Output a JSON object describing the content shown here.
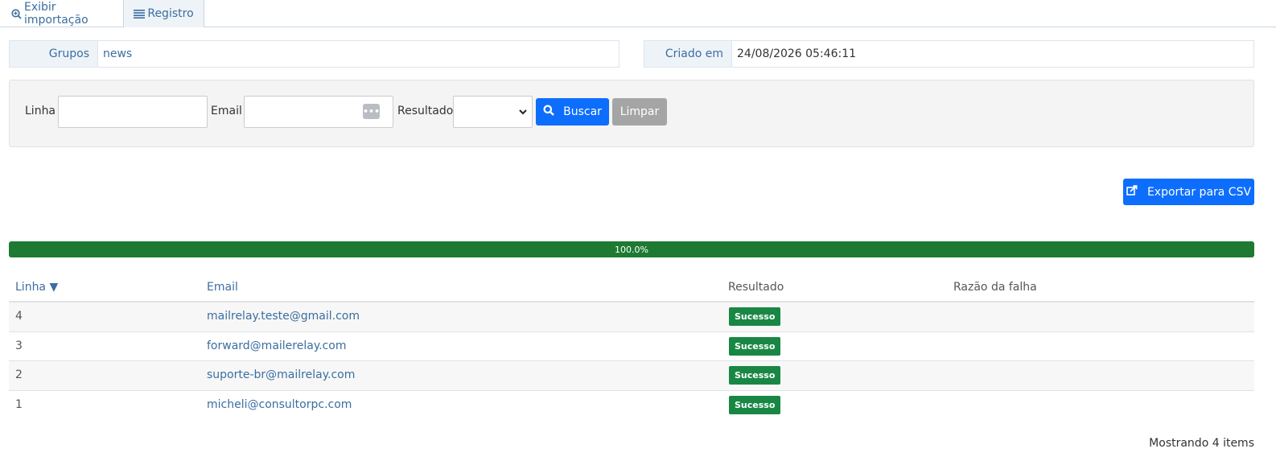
{
  "tabs": [
    {
      "label": "Exibir importação",
      "icon": "search-plus-icon"
    },
    {
      "label": "Registro",
      "icon": "list-icon"
    }
  ],
  "info": {
    "groups_label": "Grupos",
    "groups_value": "news",
    "created_label": "Criado em",
    "created_value": "24/08/2026 05:46:11"
  },
  "filter": {
    "line_label": "Linha",
    "line_value": "",
    "email_label": "Email",
    "email_value": "",
    "result_label": "Resultado",
    "result_selected": "",
    "search_label": "Buscar",
    "clear_label": "Limpar"
  },
  "export_label": "Exportar para CSV",
  "progress": {
    "value": 100.0,
    "text": "100.0%"
  },
  "colors": {
    "primary": "#0d6efd",
    "success": "#198744",
    "progress": "#1e7a32",
    "link": "#3b6ea0"
  },
  "table": {
    "columns": {
      "line": "Linha ▼",
      "email": "Email",
      "result": "Resultado",
      "reason": "Razão da falha"
    },
    "rows": [
      {
        "line": "4",
        "email": "mailrelay.teste@gmail.com",
        "result": "Sucesso",
        "reason": ""
      },
      {
        "line": "3",
        "email": "forward@mailerelay.com",
        "result": "Sucesso",
        "reason": ""
      },
      {
        "line": "2",
        "email": "suporte-br@mailrelay.com",
        "result": "Sucesso",
        "reason": ""
      },
      {
        "line": "1",
        "email": "micheli@consultorpc.com",
        "result": "Sucesso",
        "reason": ""
      }
    ]
  },
  "footer": "Mostrando 4 items"
}
